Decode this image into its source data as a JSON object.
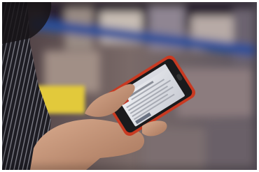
{
  "photo": {
    "alt": "",
    "colors": {
      "background_dark": "#3a3440",
      "shelf_blue": "#2b4f9a",
      "shelf_yellow": "#e2c93a",
      "shirt_dark": "#1e1d24",
      "skin": "#c99a7e",
      "phone_case": "#c83a22",
      "phone_body": "#1a1a1c",
      "screen_light": "#e6e8ec"
    }
  }
}
